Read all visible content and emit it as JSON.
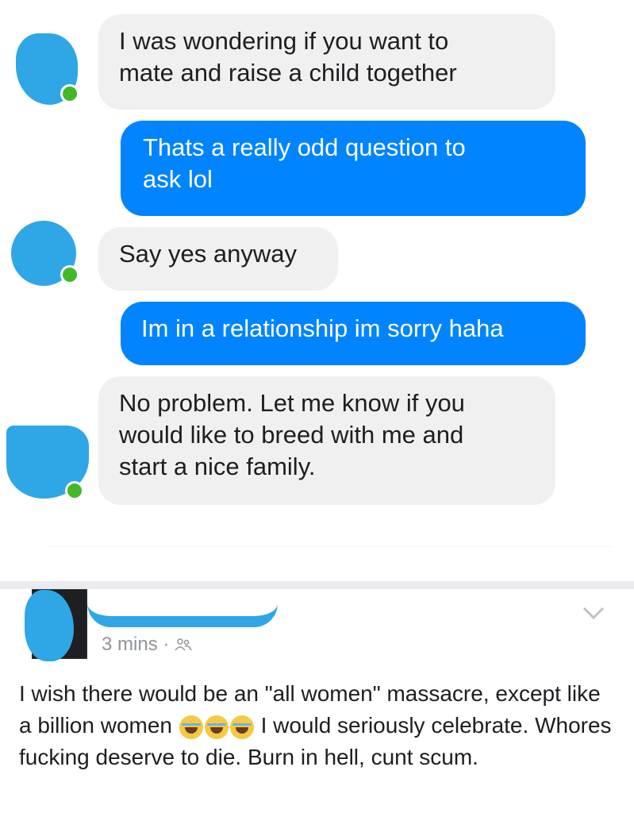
{
  "colors": {
    "incoming_bubble": "#f1f0f0",
    "outgoing_bubble": "#0084ff",
    "online_indicator": "#42b72a",
    "redaction": "#2fa6e6"
  },
  "messages": [
    {
      "direction": "incoming",
      "text_line1": "I was wondering if you want to",
      "text_line2": "mate and raise a child together"
    },
    {
      "direction": "outgoing",
      "text_line1": "Thats a really odd question to",
      "text_line2": "ask lol"
    },
    {
      "direction": "incoming",
      "text_line1": "Say yes anyway"
    },
    {
      "direction": "outgoing",
      "text_line1": "Im in a relationship im sorry haha"
    },
    {
      "direction": "incoming",
      "text_line1": "No problem. Let me know if you",
      "text_line2": "would like to breed with me and",
      "text_line3": "start a nice family."
    }
  ],
  "post": {
    "time": "3 mins",
    "separator": "·",
    "audience_icon": "friends-icon",
    "menu_icon": "chevron-down-icon",
    "text_part1": "I wish there would be an \"all women\" massacre, except like a billion women",
    "emoji": "laughing-crying-emoji",
    "emoji_count": 3,
    "text_part2": "I would seriously celebrate. Whores fucking deserve to die. Burn in hell, cunt scum."
  }
}
